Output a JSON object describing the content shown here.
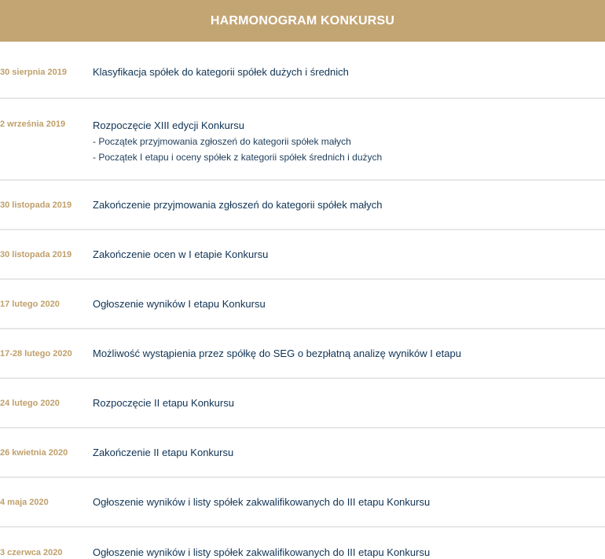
{
  "header": {
    "title": "HARMONOGRAM KONKURSU"
  },
  "schedule": [
    {
      "date": "30 sierpnia 2019",
      "title": "Klasyfikacja spółek do kategorii spółek dużych i średnich",
      "details": []
    },
    {
      "date": "2 września 2019",
      "title": "Rozpoczęcie  XIII edycji Konkursu",
      "details": [
        "- Początek przyjmowania zgłoszeń do kategorii spółek małych",
        "- Początek I etapu i oceny spółek z kategorii spółek średnich i dużych"
      ]
    },
    {
      "date": "30 listopada 2019",
      "title": "Zakończenie przyjmowania zgłoszeń do kategorii spółek małych",
      "details": []
    },
    {
      "date": "30 listopada 2019",
      "title": "Zakończenie ocen w I etapie Konkursu",
      "details": []
    },
    {
      "date": "17 lutego 2020",
      "title": "Ogłoszenie wyników I etapu Konkursu",
      "details": []
    },
    {
      "date": "17-28 lutego 2020",
      "title": "Możliwość wystąpienia przez spółkę do SEG o bezpłatną analizę wyników I etapu",
      "details": []
    },
    {
      "date": "24 lutego 2020",
      "title": "Rozpoczęcie II etapu Konkursu",
      "details": []
    },
    {
      "date": "26 kwietnia 2020",
      "title": "Zakończenie II etapu Konkursu",
      "details": []
    },
    {
      "date": "4 maja 2020",
      "title": "Ogłoszenie wyników i listy spółek zakwalifikowanych do III etapu Konkursu",
      "details": []
    },
    {
      "date": "3 czerwca 2020",
      "title": "Ogłoszenie wyników i listy spółek zakwalifikowanych do III etapu Konkursu",
      "details": []
    }
  ]
}
